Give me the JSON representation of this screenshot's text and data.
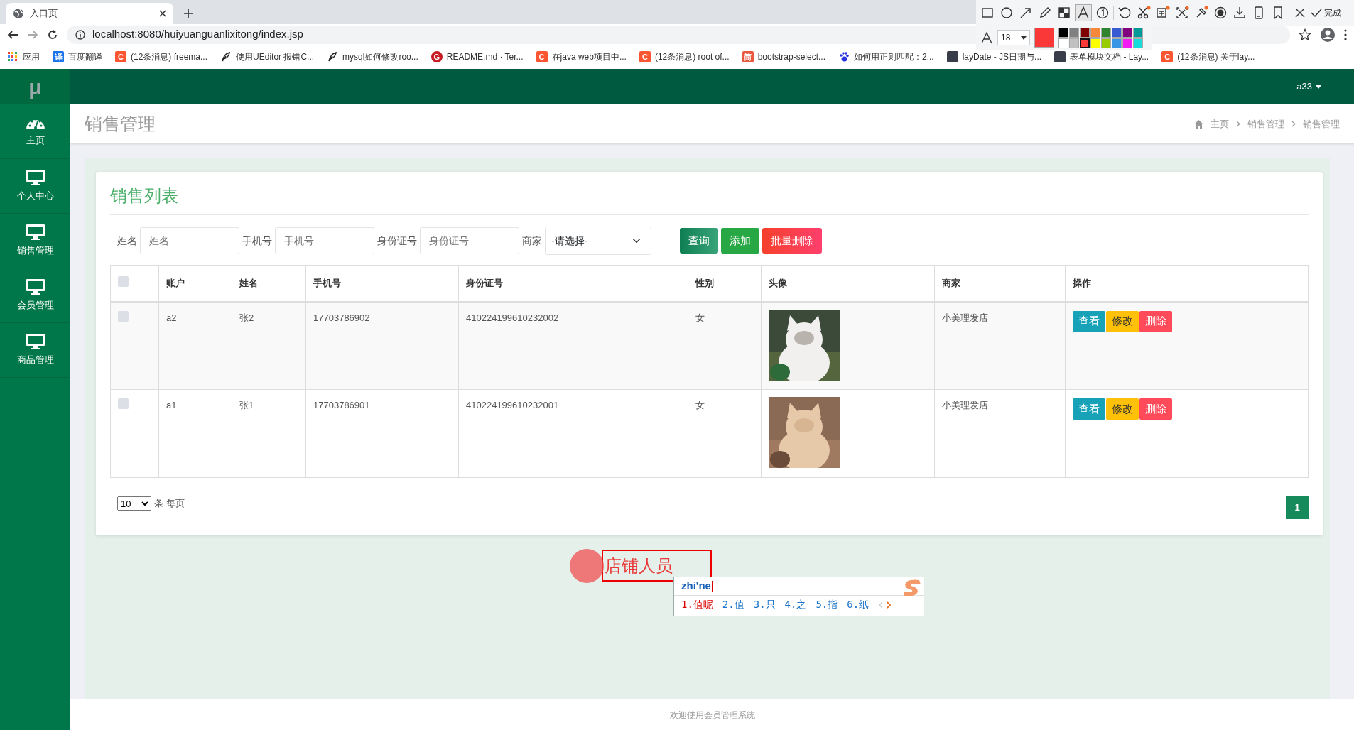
{
  "browser": {
    "tab": {
      "title": "入口页"
    },
    "address": "localhost:8080/huiyuanguanlixitong/index.jsp",
    "bookmarks": [
      {
        "kind": "apps",
        "label": "应用"
      },
      {
        "kind": "square",
        "glyph": "译",
        "color": "#1a73e8",
        "label": "百度翻译"
      },
      {
        "kind": "square",
        "glyph": "C",
        "color": "#fc5531",
        "label": "(12条消息) freema..."
      },
      {
        "kind": "feather",
        "label": "使用UEditor 报错C..."
      },
      {
        "kind": "feather",
        "label": "mysql如何修改roo..."
      },
      {
        "kind": "circle",
        "glyph": "G",
        "color": "#c71d23",
        "label": "README.md · Ter..."
      },
      {
        "kind": "square",
        "glyph": "C",
        "color": "#fc5531",
        "label": "在java web项目中..."
      },
      {
        "kind": "square",
        "glyph": "C",
        "color": "#fc5531",
        "label": "(12条消息) root of..."
      },
      {
        "kind": "square",
        "glyph": "简",
        "color": "#e9573f",
        "label": "bootstrap-select..."
      },
      {
        "kind": "paw",
        "label": "如何用正则匹配：2..."
      },
      {
        "kind": "square",
        "color": "#393d49",
        "label": "layDate - JS日期与..."
      },
      {
        "kind": "square",
        "color": "#393d49",
        "label": "表单模块文档 - Lay..."
      },
      {
        "kind": "square",
        "glyph": "C",
        "color": "#fc5531",
        "label": "(12条消息) 关于lay..."
      }
    ]
  },
  "app": {
    "logo": "μ",
    "user": "a33",
    "sidebar": [
      {
        "kind": "dashboard",
        "label": "主页"
      },
      {
        "kind": "monitor",
        "label": "个人中心"
      },
      {
        "kind": "monitor",
        "label": "销售管理"
      },
      {
        "kind": "monitor",
        "label": "会员管理"
      },
      {
        "kind": "monitor",
        "label": "商品管理"
      }
    ],
    "page_title": "销售管理",
    "breadcrumb": [
      "主页",
      "销售管理",
      "销售管理"
    ],
    "card_title": "销售列表",
    "filters": [
      {
        "label": "姓名",
        "placeholder": "姓名"
      },
      {
        "label": "手机号",
        "placeholder": "手机号"
      },
      {
        "label": "身份证号",
        "placeholder": "身份证号"
      }
    ],
    "merchant_filter": {
      "label": "商家",
      "value": "-请选择-"
    },
    "actions": [
      {
        "kind": "query",
        "label": "查询"
      },
      {
        "kind": "add",
        "label": "添加"
      },
      {
        "kind": "danger",
        "label": "批量删除"
      }
    ],
    "table": {
      "select_all_checked": false,
      "columns": [
        "账户",
        "姓名",
        "手机号",
        "身份证号",
        "性别",
        "头像",
        "商家",
        "操作"
      ],
      "rows": [
        {
          "checked": false,
          "cells": [
            "a2",
            "张2",
            "17703786902",
            "410224199610232002",
            "女"
          ],
          "avatar": {
            "kind": "picture"
          },
          "merchant": "小美理发店",
          "buttons": [
            {
              "kind": "view",
              "label": "查看"
            },
            {
              "kind": "edit",
              "label": "修改"
            },
            {
              "kind": "delete",
              "label": "删除"
            }
          ]
        },
        {
          "checked": false,
          "cells": [
            "a1",
            "张1",
            "17703786901",
            "410224199610232001",
            "女"
          ],
          "avatar": {
            "kind": "picture"
          },
          "merchant": "小美理发店",
          "buttons": [
            {
              "kind": "view",
              "label": "查看"
            },
            {
              "kind": "edit",
              "label": "修改"
            },
            {
              "kind": "delete",
              "label": "删除"
            }
          ]
        }
      ]
    },
    "page_size": {
      "value": "10",
      "suffix": "条 每页"
    },
    "pages": [
      {
        "label": "1",
        "selected": true
      }
    ],
    "footer": "欢迎使用会员管理系统"
  },
  "annotation": {
    "text": "店铺人员"
  },
  "ime": {
    "composition": "zhi'ne",
    "candidates": [
      {
        "label": "1.值呢",
        "selected": true
      },
      {
        "label": "2.值",
        "selected": false
      },
      {
        "label": "3.只",
        "selected": false
      },
      {
        "label": "4.之",
        "selected": false
      },
      {
        "label": "5.指",
        "selected": false
      },
      {
        "label": "6.纸",
        "selected": false
      }
    ]
  },
  "capture_toolbar": {
    "tools": [
      {
        "kind": "rect",
        "selected": false
      },
      {
        "kind": "ellipse",
        "selected": false
      },
      {
        "kind": "arrow",
        "selected": false
      },
      {
        "kind": "pen",
        "selected": false
      },
      {
        "kind": "mosaic",
        "selected": false
      },
      {
        "kind": "text",
        "selected": true
      },
      {
        "kind": "number",
        "selected": false
      },
      {
        "kind": "divider"
      },
      {
        "kind": "undo",
        "selected": false
      },
      {
        "kind": "cut",
        "selected": false
      },
      {
        "kind": "ocr",
        "selected": false
      },
      {
        "kind": "crop",
        "selected": false
      },
      {
        "kind": "pin",
        "selected": false
      },
      {
        "kind": "record",
        "selected": false
      },
      {
        "kind": "save",
        "selected": false
      },
      {
        "kind": "phone",
        "selected": false
      },
      {
        "kind": "bookmark",
        "selected": false
      },
      {
        "kind": "divider"
      },
      {
        "kind": "close",
        "selected": false
      }
    ],
    "done_label": "完成",
    "font_size": "18",
    "palette": [
      {
        "color": "#000000",
        "selected": false
      },
      {
        "color": "#808080",
        "selected": false
      },
      {
        "color": "#800000",
        "selected": false
      },
      {
        "color": "#f7883a",
        "selected": false
      },
      {
        "color": "#308430",
        "selected": false
      },
      {
        "color": "#385ad3",
        "selected": false
      },
      {
        "color": "#800080",
        "selected": false
      },
      {
        "color": "#009999",
        "selected": false
      },
      {
        "color": "#ffffff",
        "selected": false
      },
      {
        "color": "#c0c0c0",
        "selected": false
      },
      {
        "color": "#fb3838",
        "selected": true
      },
      {
        "color": "#ffff00",
        "selected": false
      },
      {
        "color": "#99cc00",
        "selected": false
      },
      {
        "color": "#3894e4",
        "selected": false
      },
      {
        "color": "#f31bf3",
        "selected": false
      },
      {
        "color": "#16dcdc",
        "selected": false
      }
    ]
  }
}
